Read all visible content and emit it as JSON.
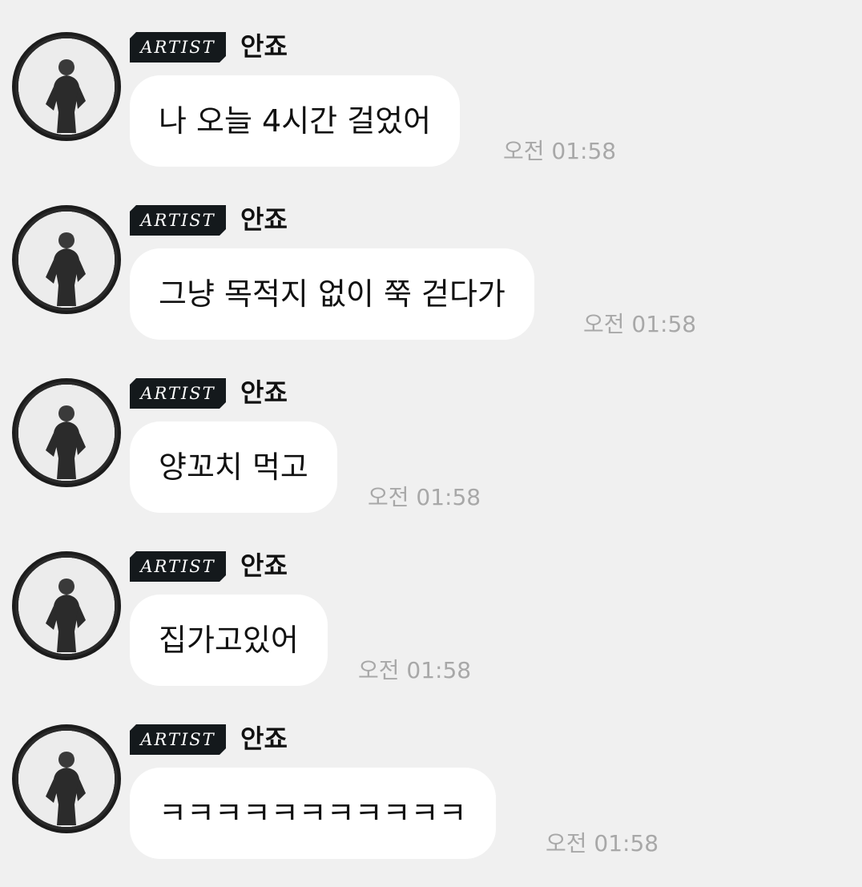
{
  "messages": [
    {
      "badge": "ARTIST",
      "sender": "안죠",
      "text": "나 오늘 4시간 걸었어",
      "time": "오전 01:58"
    },
    {
      "badge": "ARTIST",
      "sender": "안죠",
      "text": "그냥 목적지 없이 쭉 걷다가",
      "time": "오전 01:58"
    },
    {
      "badge": "ARTIST",
      "sender": "안죠",
      "text": "양꼬치 먹고",
      "time": "오전 01:58"
    },
    {
      "badge": "ARTIST",
      "sender": "안죠",
      "text": "집가고있어",
      "time": "오전 01:58"
    },
    {
      "badge": "ARTIST",
      "sender": "안죠",
      "text": "ㅋㅋㅋㅋㅋㅋㅋㅋㅋㅋㅋ",
      "time": "오전 01:58"
    }
  ],
  "colors": {
    "background": "#f0f0f0",
    "bubble": "#ffffff",
    "badge": "#14191c",
    "time": "#a8a8a8"
  },
  "icons": {
    "avatar": "profile-photo-avatar"
  }
}
